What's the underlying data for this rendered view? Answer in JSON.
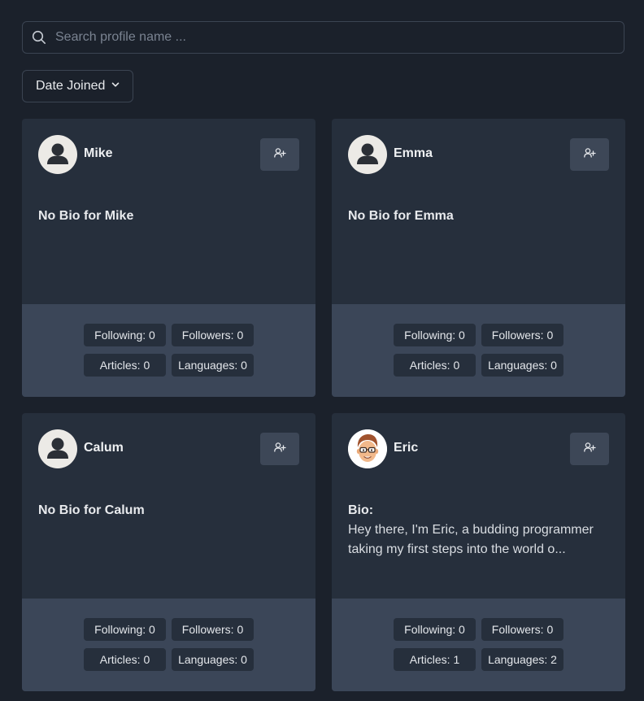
{
  "search": {
    "placeholder": "Search profile name ...",
    "icon": "search-icon"
  },
  "sort": {
    "label": "Date Joined",
    "icon": "chevron-down-icon"
  },
  "colors": {
    "background": "#1b212b",
    "card_top": "#262f3c",
    "card_bottom": "#3b4658",
    "stat_badge": "#262f3c",
    "follow_button": "#3d4757"
  },
  "profiles": [
    {
      "name": "Mike",
      "avatar": "default-avatar-icon",
      "bio_title": "No Bio for Mike",
      "bio_text": "",
      "stats": {
        "following": "Following: 0",
        "followers": "Followers: 0",
        "articles": "Articles: 0",
        "languages": "Languages: 0"
      }
    },
    {
      "name": "Emma",
      "avatar": "default-avatar-icon",
      "bio_title": "No Bio for Emma",
      "bio_text": "",
      "stats": {
        "following": "Following: 0",
        "followers": "Followers: 0",
        "articles": "Articles: 0",
        "languages": "Languages: 0"
      }
    },
    {
      "name": "Calum",
      "avatar": "default-avatar-icon",
      "bio_title": "No Bio for Calum",
      "bio_text": "",
      "stats": {
        "following": "Following: 0",
        "followers": "Followers: 0",
        "articles": "Articles: 0",
        "languages": "Languages: 0"
      }
    },
    {
      "name": "Eric",
      "avatar": "cartoon-avatar",
      "bio_title": "Bio:",
      "bio_text": "Hey there, I'm Eric, a budding programmer taking my first steps into the world o...",
      "stats": {
        "following": "Following: 0",
        "followers": "Followers: 0",
        "articles": "Articles: 1",
        "languages": "Languages: 2"
      }
    }
  ]
}
